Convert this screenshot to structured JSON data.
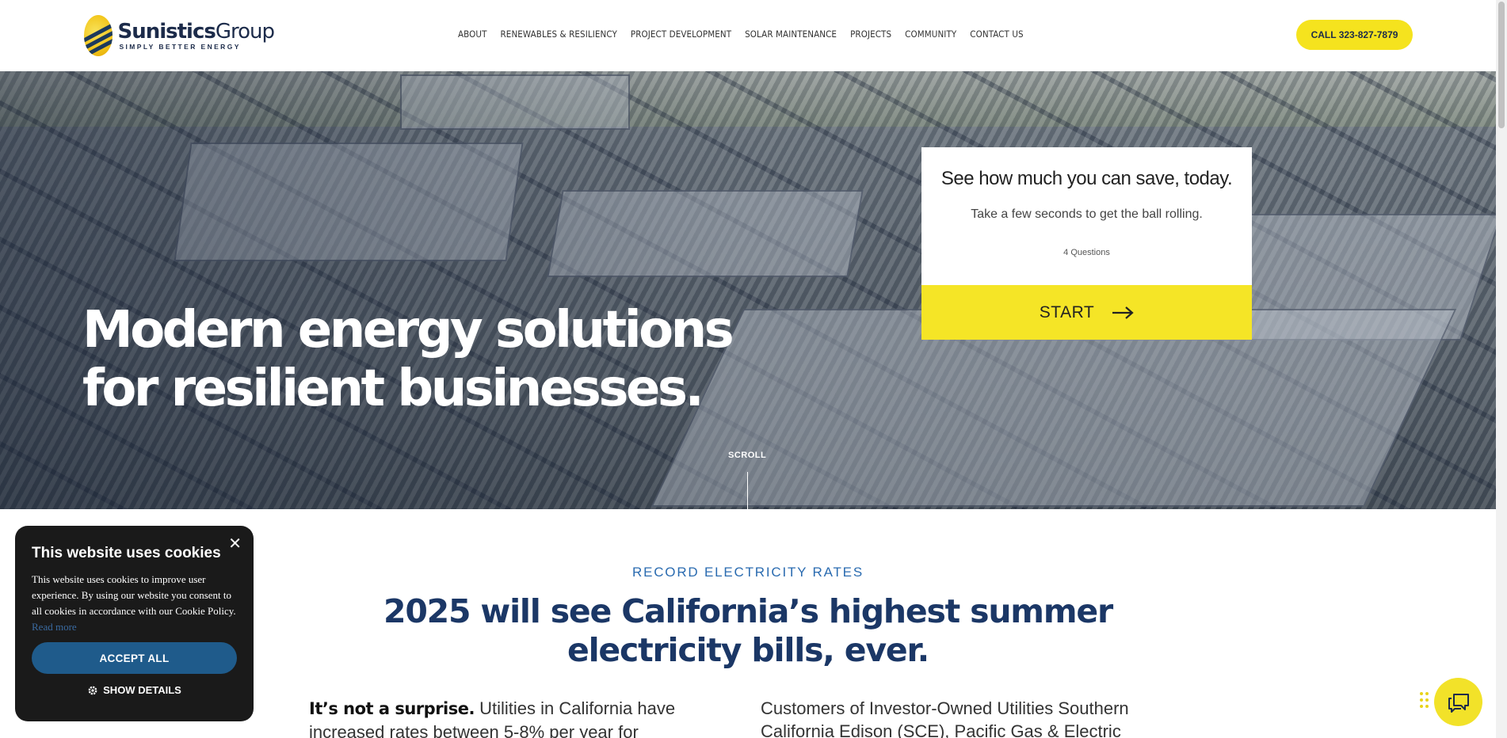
{
  "header": {
    "logo": {
      "name_bold": "Sunistics",
      "name_light": "Group",
      "tagline": "SIMPLY BETTER ENERGY"
    },
    "nav": [
      "ABOUT",
      "RENEWABLES & RESILIENCY",
      "PROJECT DEVELOPMENT",
      "SOLAR MAINTENANCE",
      "PROJECTS",
      "COMMUNITY",
      "CONTACT US"
    ],
    "call_button": "CALL 323-827-7879"
  },
  "hero": {
    "title_line1": "Modern energy solutions",
    "title_line2": "for resilient businesses.",
    "scroll_label": "SCROLL"
  },
  "savings_card": {
    "title": "See how much you can save, today.",
    "subtitle": "Take a few seconds to get the ball rolling.",
    "question_count": "4 Questions",
    "start_label": "START",
    "start_icon": "arrow-right-icon"
  },
  "content": {
    "eyebrow": "RECORD ELECTRICITY RATES",
    "headline": "2025 will see California’s highest summer electricity bills, ever.",
    "col_left_bold": "It’s not a surprise.",
    "col_left_text": " Utilities in California have increased rates between 5-8% per year for",
    "col_right_text": "Customers of Investor-Owned Utilities Southern California Edison (SCE), Pacific Gas & Electric"
  },
  "cookie": {
    "title": "This website uses cookies",
    "text": "This website uses cookies to improve user experience. By using our website you consent to all cookies in accordance with our Cookie Policy.",
    "read_more": "Read more",
    "accept": "ACCEPT ALL",
    "details": "SHOW DETAILS",
    "close_icon": "close-icon",
    "details_icon": "gear-icon"
  },
  "chat": {
    "icon": "chat-icon"
  },
  "colors": {
    "brand_yellow": "#f5e31e",
    "brand_navy": "#1b3766",
    "accent_blue": "#2a6bb0",
    "cookie_button": "#1f5b8b"
  }
}
